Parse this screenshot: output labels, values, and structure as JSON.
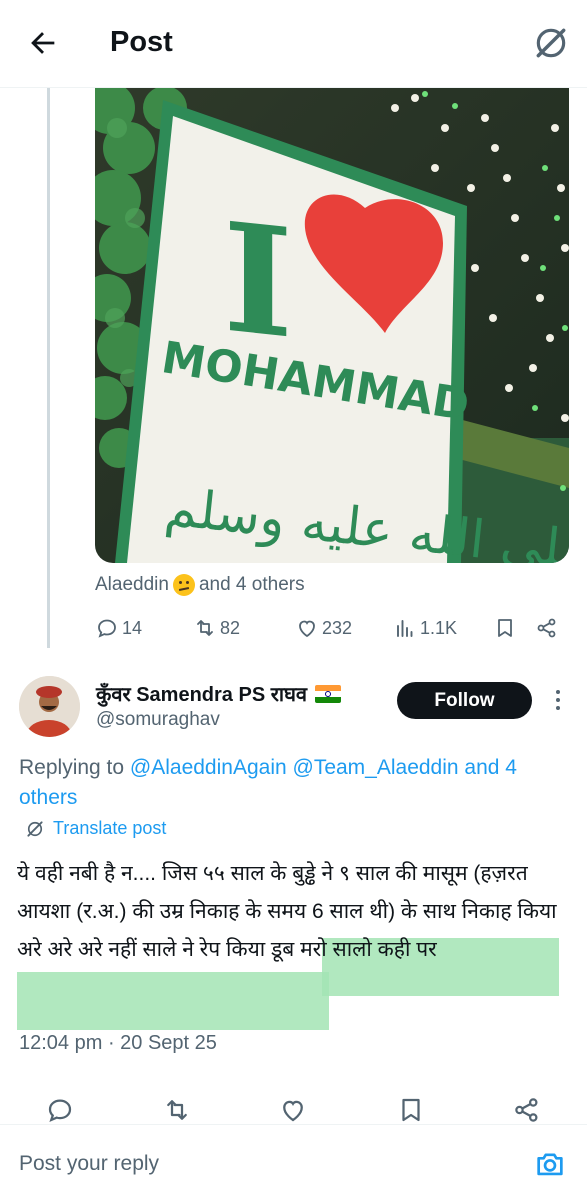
{
  "header": {
    "title": "Post",
    "back_icon": "arrow-left-icon",
    "grok_icon": "grok-icon"
  },
  "quoted_image": {
    "sign_big_letter": "I",
    "sign_word": "MOHAMMAD",
    "sign_arabic": "صلى الله عليه وسلم"
  },
  "likers": {
    "prefix": "Alaeddin",
    "suffix": "and 4 others"
  },
  "parent_actions": {
    "replies": "14",
    "reposts": "82",
    "likes": "232",
    "views": "1.1K"
  },
  "reply": {
    "display_name": "कुँवर Samendra PS राघव",
    "handle": "@somuraghav",
    "follow_label": "Follow",
    "replying_prefix": "Replying to",
    "replying_to": "@AlaeddinAgain @Team_Alaeddin and 4 others",
    "translate_label": "Translate post",
    "text": "ये वही नबी है न.... जिस ५५ साल के बुड्ढे ने ९ साल की मासूम (हज़रत आयशा (र.अ.) की उम्र निकाह के समय 6 साल थी) के साथ निकाह किया अरे अरे अरे नहीं साले ने रेप किया डूब मरो सालो कही पर",
    "timestamp": "12:04 pm · 20 Sept 25"
  },
  "reply_bar": {
    "placeholder": "Post your reply",
    "camera_icon": "camera-icon"
  },
  "colors": {
    "accent": "#1d9bf0",
    "text_secondary": "#536471",
    "highlight": "#a3e4b4",
    "sign_green": "#2e8b57",
    "heart_red": "#e8403a"
  }
}
